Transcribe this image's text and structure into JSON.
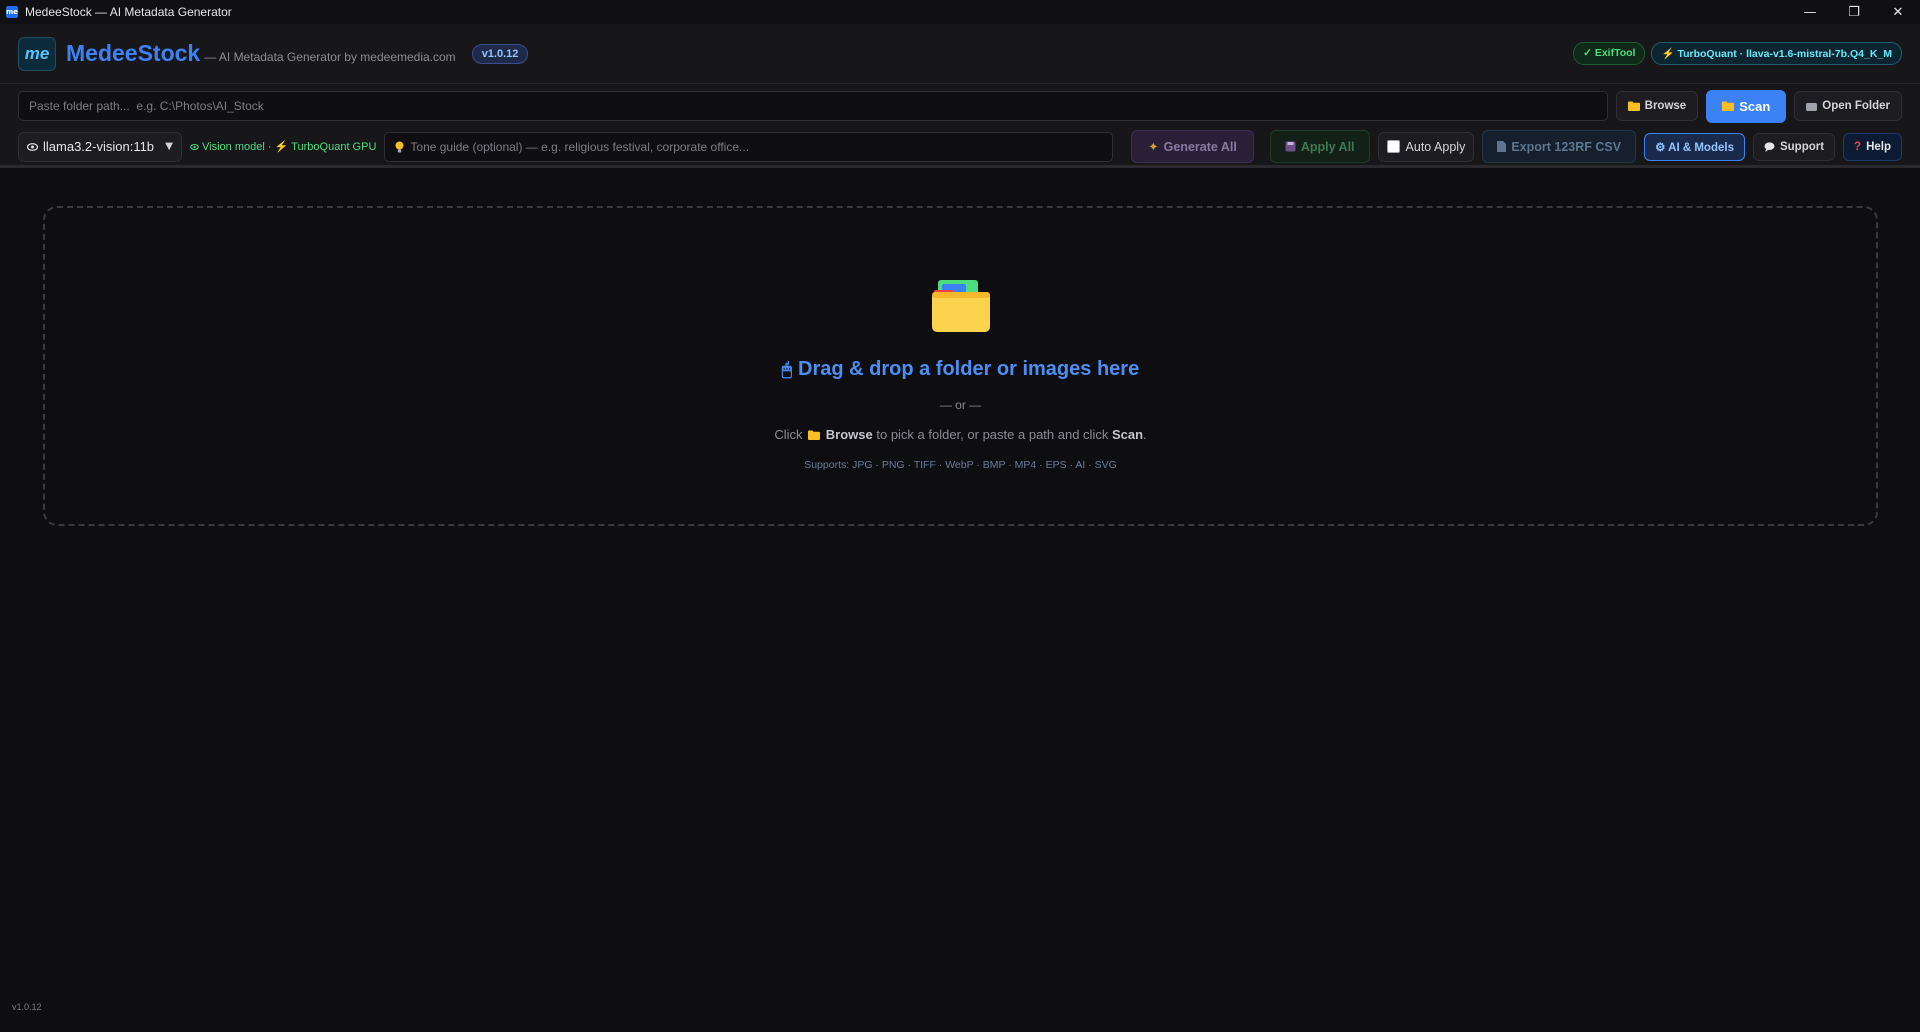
{
  "window": {
    "title": "MedeeStock — AI Metadata Generator",
    "app_icon_text": "me",
    "controls": {
      "minimize": "—",
      "restore": "❐",
      "close": "✕"
    }
  },
  "header": {
    "logo_text": "me",
    "brand": "MedeeStock",
    "subtitle": "— AI Metadata Generator by medeemedia.com",
    "version": "v1.0.12",
    "badges": {
      "exiftool": "✓ ExifTool",
      "turbo_bolt": "⚡",
      "turbo": "TurboQuant · llava-v1.6-mistral-7b.Q4_K_M"
    }
  },
  "toolbar": {
    "path_placeholder": "Paste folder path...  e.g. C:\\Photos\\AI_Stock",
    "browse_label": "Browse",
    "scan_label": "Scan",
    "open_folder_label": "Open Folder",
    "model": "llama3.2-vision:11b",
    "vision_model_label": "Vision model ·",
    "turboquant_label": "TurboQuant GPU",
    "tone_placeholder": "Tone guide (optional) — e.g. religious festival, corporate office...",
    "generate_all_label": "Generate All",
    "apply_all_label": "Apply All",
    "auto_apply_label": "Auto Apply",
    "export_label": "Export 123RF CSV",
    "ai_models_label": "⚙ AI & Models",
    "support_label": "Support",
    "help_label": "Help"
  },
  "dropzone": {
    "title": "Drag & drop a folder or images here",
    "or": "— or —",
    "hint_click": "Click",
    "hint_browse": "Browse",
    "hint_middle": "to pick a folder, or paste a path and click",
    "hint_scan": "Scan",
    "hint_end": ".",
    "supports": "Supports: JPG · PNG · TIFF · WebP · BMP · MP4 · EPS · AI · SVG"
  },
  "footer": {
    "version": "v1.0.12"
  },
  "colors": {
    "accent": "#3b82f6",
    "success": "#4ade80",
    "bolt": "#f97316",
    "background": "#0e0e10"
  }
}
